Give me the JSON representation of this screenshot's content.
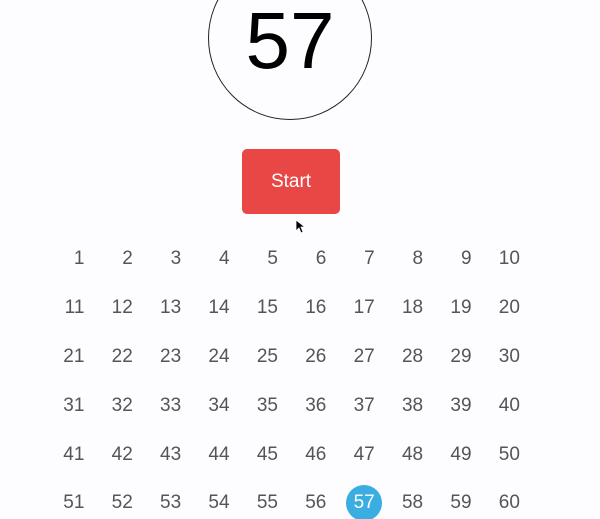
{
  "display": {
    "current_number": "57"
  },
  "controls": {
    "start_label": "Start"
  },
  "board": {
    "selected": "57",
    "highlight_color": "#3aaee2",
    "numbers": [
      "1",
      "2",
      "3",
      "4",
      "5",
      "6",
      "7",
      "8",
      "9",
      "10",
      "11",
      "12",
      "13",
      "14",
      "15",
      "16",
      "17",
      "18",
      "19",
      "20",
      "21",
      "22",
      "23",
      "24",
      "25",
      "26",
      "27",
      "28",
      "29",
      "30",
      "31",
      "32",
      "33",
      "34",
      "35",
      "36",
      "37",
      "38",
      "39",
      "40",
      "41",
      "42",
      "43",
      "44",
      "45",
      "46",
      "47",
      "48",
      "49",
      "50",
      "51",
      "52",
      "53",
      "54",
      "55",
      "56",
      "57",
      "58",
      "59",
      "60"
    ]
  },
  "colors": {
    "start_button": "#e94646",
    "number_text": "#555555"
  }
}
